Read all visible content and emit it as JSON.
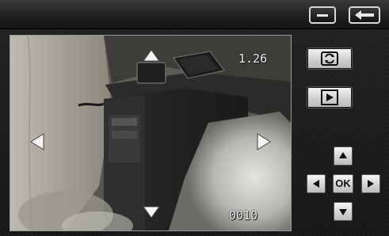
{
  "viewer": {
    "zoom_readout": "1.26",
    "frame_counter": "0010"
  },
  "dpad": {
    "ok_label": "OK"
  },
  "icons": {
    "minimize": "minus-icon",
    "back": "back-arrow-icon",
    "switch_camera": "camera-switch-icon",
    "play": "play-icon"
  }
}
